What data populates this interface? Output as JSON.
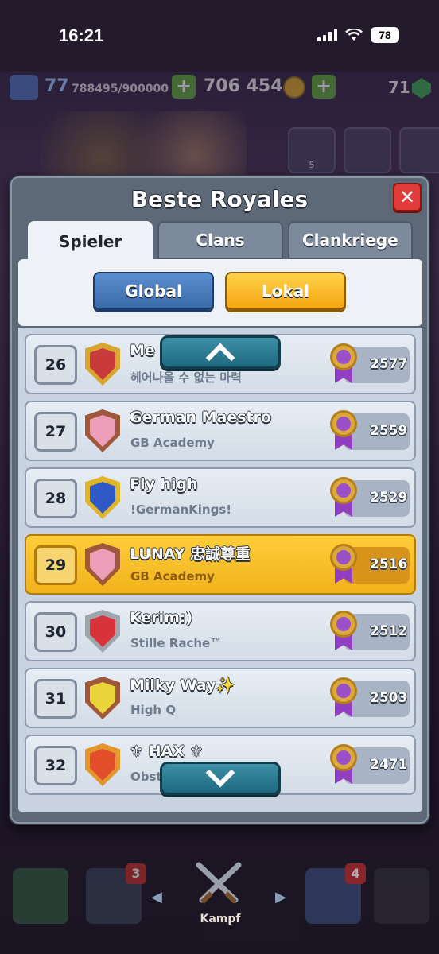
{
  "status_bar": {
    "time": "16:21",
    "battery": "78"
  },
  "game_topbar": {
    "level": "77",
    "xp": "788495/900000",
    "gold": "706 454",
    "gems": "71"
  },
  "bg_friends_count": "5",
  "modal": {
    "title": "Beste Royales",
    "tabs": [
      {
        "label": "Spieler",
        "active": true
      },
      {
        "label": "Clans",
        "active": false
      },
      {
        "label": "Clankriege",
        "active": false
      }
    ],
    "filters": [
      {
        "label": "Global",
        "active": false
      },
      {
        "label": "Lokal",
        "active": true
      }
    ]
  },
  "leaderboard": [
    {
      "rank": "26",
      "name": "Me",
      "clan": "헤어나올 수 없는 마력",
      "trophies": "2577",
      "shield_color": "#d8a52e",
      "emblem_color": "#c93a3a"
    },
    {
      "rank": "27",
      "name": "German Maestro",
      "clan": "GB Academy",
      "trophies": "2559",
      "shield_color": "#a0583a",
      "emblem_color": "#ec9fb8"
    },
    {
      "rank": "28",
      "name": "Fly high",
      "clan": "!GermanKings!",
      "trophies": "2529",
      "shield_color": "#e0b526",
      "emblem_color": "#2f59c6"
    },
    {
      "rank": "29",
      "name": "LUNAY 忠誠尊重",
      "clan": "GB Academy",
      "trophies": "2516",
      "shield_color": "#a0583a",
      "emblem_color": "#ec9fb8",
      "is_me": true
    },
    {
      "rank": "30",
      "name": "Kerim:)",
      "clan": "Stille Rache™",
      "trophies": "2512",
      "shield_color": "#9ea5ad",
      "emblem_color": "#d8333a"
    },
    {
      "rank": "31",
      "name": "Milky Way✨",
      "clan": "High Q",
      "trophies": "2503",
      "shield_color": "#a0583a",
      "emblem_color": "#e9d43a"
    },
    {
      "rank": "32",
      "name": "⚜ HAX ⚜",
      "clan": "Obst",
      "trophies": "2471",
      "shield_color": "#e3962a",
      "emblem_color": "#e24d2a"
    }
  ],
  "bottom_nav": {
    "cards_badge": "3",
    "battle_label": "Kampf",
    "clan_badge": "4"
  }
}
